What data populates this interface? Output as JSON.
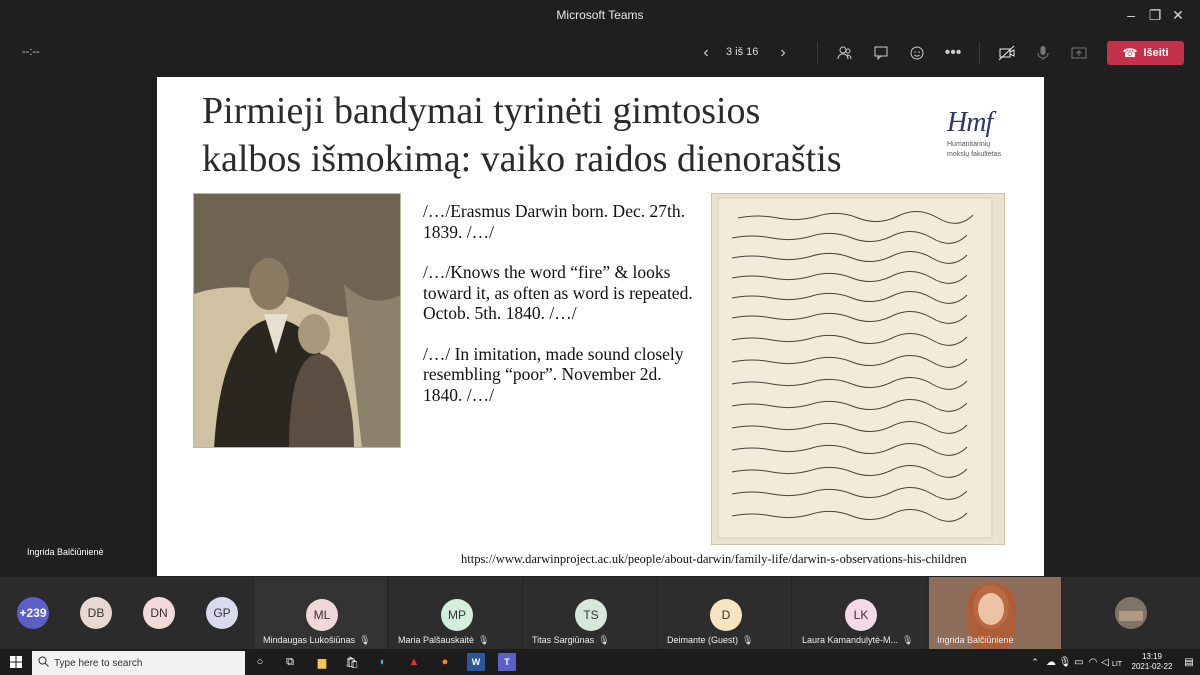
{
  "window": {
    "title": "Microsoft Teams"
  },
  "toolbar": {
    "timer": "--:--",
    "pager": "3 iš 16",
    "leave_label": "Išeiti"
  },
  "slide": {
    "title_line1": "Pirmieji bandymai tyrinėti gimtosios",
    "title_line2": "kalbos išmokimą: vaiko raidos dienoraštis",
    "logo_mark": "Hmf",
    "logo_sub1": "Humanitarinių",
    "logo_sub2": "mokslų fakultetas",
    "quotes": [
      "/…/Erasmus Darwin born. Dec. 27th. 1839. /…/",
      "/…/Knows the word “fire” & looks toward it, as often as word is repeated. Octob. 5th. 1840. /…/",
      "/…/ In imitation, made sound closely resembling “poor”. November 2d. 1840. /…/"
    ],
    "url": "https://www.darwinproject.ac.uk/people/about-darwin/family-life/darwin-s-observations-his-children"
  },
  "presenter": {
    "name": "Ingrida Balčiūnienė"
  },
  "participants": {
    "overflow": "+239",
    "bubbles": [
      {
        "initials": "DB",
        "color": "#e8d8d2"
      },
      {
        "initials": "DN",
        "color": "#f3d9d9"
      },
      {
        "initials": "GP",
        "color": "#d9d9f0"
      }
    ],
    "tiles": [
      {
        "initials": "ML",
        "name": "Mindaugas Lukošiūnas",
        "color": "#f1d6da"
      },
      {
        "initials": "MP",
        "name": "Maria Palšauskaitė",
        "color": "#d4eedc"
      },
      {
        "initials": "TS",
        "name": "Titas Sargiūnas",
        "color": "#d7e7dc"
      },
      {
        "initials": "D",
        "name": "Deimante (Guest)",
        "color": "#f7e4c1"
      },
      {
        "initials": "LK",
        "name": "Laura Kamandulytė-M...",
        "color": "#f6d9e6"
      },
      {
        "initials": "",
        "name": "Ingrida Balčiūnienė",
        "color": "#9b6a4f"
      }
    ]
  },
  "taskbar": {
    "search_placeholder": "Type here to search",
    "lang": "LIT",
    "time": "13:19",
    "date": "2021-02-22"
  }
}
